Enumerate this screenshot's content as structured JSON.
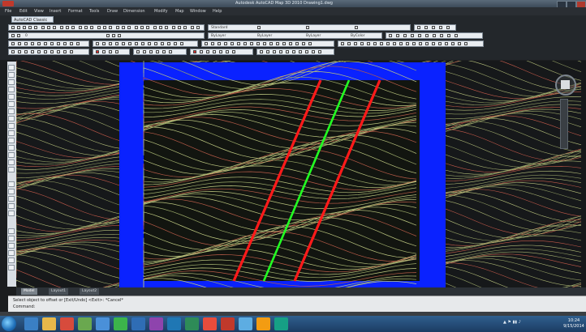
{
  "window": {
    "title": "Autodesk AutoCAD Map 3D 2010  Drawing1.dwg"
  },
  "menu": {
    "items": [
      "File",
      "Edit",
      "View",
      "Insert",
      "Format",
      "Tools",
      "Draw",
      "Dimension",
      "Modify",
      "Map",
      "Window",
      "Help"
    ]
  },
  "ribbon": {
    "workspace_tab": "AutoCAD Classic",
    "layer_field": "0",
    "style_field": "Standard",
    "color_field": "ByLayer",
    "linetype_field": "ByLayer",
    "lineweight_field": "ByLayer",
    "plot_field": "ByColor"
  },
  "layout_tabs": [
    "Model",
    "Layout1",
    "Layout2"
  ],
  "command": {
    "history": "Select object to offset or [Exit/Undo] <Exit>: *Cancel*",
    "prompt": "Command:"
  },
  "taskbar": {
    "clock_time": "10:24",
    "clock_date": "9/15/2014"
  },
  "colors": {
    "frame": "#0a22ff",
    "offset_lines": "#ff1a1a",
    "centerline": "#22ff22",
    "contours": "#b7c17c"
  }
}
